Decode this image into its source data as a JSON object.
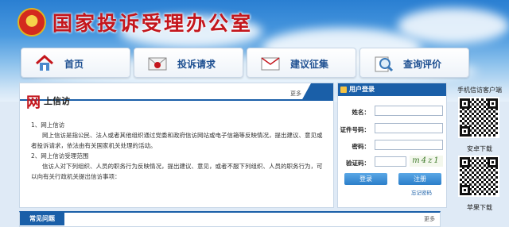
{
  "site": {
    "title": "国家投诉受理办公室"
  },
  "nav": [
    {
      "label": "首页",
      "icon": "house-icon"
    },
    {
      "label": "投诉请求",
      "icon": "envelope-icon"
    },
    {
      "label": "建议征集",
      "icon": "mail-icon"
    },
    {
      "label": "查询评价",
      "icon": "magnifier-icon"
    }
  ],
  "main": {
    "big_char": "网",
    "title": "上信访",
    "more": "更多",
    "item1_heading": "1、网上信访",
    "item1_text": "网上信访是指公民、法人或者其他组织通过党委和政府信访网站或电子信箱等反映情况，提出建议、意见或者投诉请求，依法由有关国家机关处理的活动。",
    "item2_heading": "2、网上信访受理范围",
    "item2_text": "信访人对下列组织、人员的职务行为反映情况，提出建议、意见，或者不服下列组织、人员的职务行为，可以向有关行政机关提出信访事项："
  },
  "bottom": {
    "tab": "常见问题",
    "more": "更多"
  },
  "login": {
    "header": "用户登录",
    "name_label": "姓名：",
    "id_label": "证件号码：",
    "password_label": "密码：",
    "captcha_label": "验证码：",
    "captcha_text": "m4z1",
    "login_button": "登录",
    "register_button": "注册",
    "forgot": "忘记密码"
  },
  "side": {
    "client_label": "手机信访客户端",
    "android_label": "安卓下载",
    "apple_label": "苹果下载"
  },
  "colors": {
    "brand_red": "#c4161c",
    "brand_blue": "#1a5fa8"
  }
}
